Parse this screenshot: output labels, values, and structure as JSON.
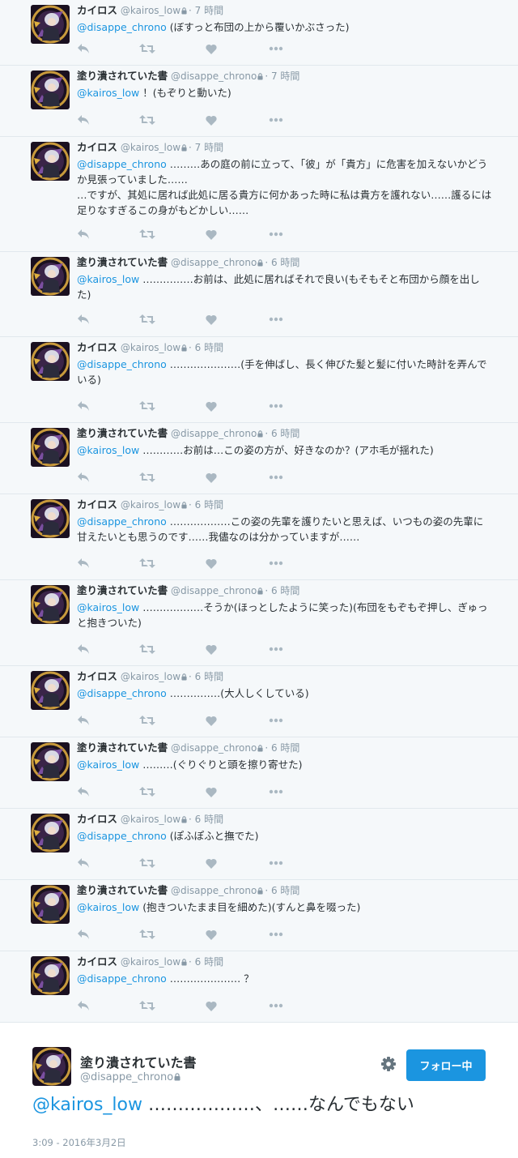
{
  "tweets": [
    {
      "fullname": "カイロス",
      "username": "@kairos_low",
      "time": "· 7 時間",
      "mention": "@disappe_chrono",
      "text": " (ぼすっと布団の上から覆いかぶさった)"
    },
    {
      "fullname": "塗り潰されていた書",
      "username": "@disappe_chrono",
      "time": "· 7 時間",
      "mention": "@kairos_low",
      "text": " ！(もぞりと動いた)"
    },
    {
      "fullname": "カイロス",
      "username": "@kairos_low",
      "time": "· 7 時間",
      "mention": "@disappe_chrono",
      "text": " ………あの庭の前に立って、「彼」が「貴方」に危害を加えないかどうか見張っていました……\n…ですが、其処に居れば此処に居る貴方に何かあった時に私は貴方を護れない……護るには足りなすぎるこの身がもどかしい……"
    },
    {
      "fullname": "塗り潰されていた書",
      "username": "@disappe_chrono",
      "time": "· 6 時間",
      "mention": "@kairos_low",
      "text": " ……………お前は、此処に居ればそれで良い(もそもそと布団から顔を出した)"
    },
    {
      "fullname": "カイロス",
      "username": "@kairos_low",
      "time": "· 6 時間",
      "mention": "@disappe_chrono",
      "text": " …………………(手を伸ばし、長く伸びた髪と髪に付いた時計を弄んでいる)"
    },
    {
      "fullname": "塗り潰されていた書",
      "username": "@disappe_chrono",
      "time": "· 6 時間",
      "mention": "@kairos_low",
      "text": " …………お前は…この姿の方が、好きなのか？(アホ毛が揺れた)"
    },
    {
      "fullname": "カイロス",
      "username": "@kairos_low",
      "time": "· 6 時間",
      "mention": "@disappe_chrono",
      "text": " ………………この姿の先輩を護りたいと思えば、いつもの姿の先輩に甘えたいとも思うのです……我儘なのは分かっていますが……"
    },
    {
      "fullname": "塗り潰されていた書",
      "username": "@disappe_chrono",
      "time": "· 6 時間",
      "mention": "@kairos_low",
      "text": " ………………そうか(ほっとしたように笑った)(布団をもぞもぞ押し、ぎゅっと抱きついた)"
    },
    {
      "fullname": "カイロス",
      "username": "@kairos_low",
      "time": "· 6 時間",
      "mention": "@disappe_chrono",
      "text": " ……………(大人しくしている)"
    },
    {
      "fullname": "塗り潰されていた書",
      "username": "@disappe_chrono",
      "time": "· 6 時間",
      "mention": "@kairos_low",
      "text": " ………(ぐりぐりと頭を擦り寄せた)"
    },
    {
      "fullname": "カイロス",
      "username": "@kairos_low",
      "time": "· 6 時間",
      "mention": "@disappe_chrono",
      "text": " (ぽふぽふと撫でた)"
    },
    {
      "fullname": "塗り潰されていた書",
      "username": "@disappe_chrono",
      "time": "· 6 時間",
      "mention": "@kairos_low",
      "text": " (抱きついたまま目を細めた)(すんと鼻を啜った)"
    },
    {
      "fullname": "カイロス",
      "username": "@kairos_low",
      "time": "· 6 時間",
      "mention": "@disappe_chrono",
      "text": " ………………… ？"
    }
  ],
  "focus": {
    "fullname": "塗り潰されていた書",
    "username": "@disappe_chrono",
    "follow_label": "フォロー中",
    "mention": "@kairos_low",
    "text": " ………………、……なんでもない",
    "meta": "3:09 - 2016年3月2日"
  },
  "icons": {
    "reply": "reply-icon",
    "retweet": "retweet-icon",
    "like": "heart-icon",
    "more": "more-icon",
    "lock": "lock-icon",
    "gear": "gear-icon"
  },
  "colors": {
    "link": "#1b95e0",
    "muted": "#8899a6",
    "icon": "#aab8c2",
    "feed_bg": "#f5f8fa",
    "button": "#1b95e0"
  }
}
